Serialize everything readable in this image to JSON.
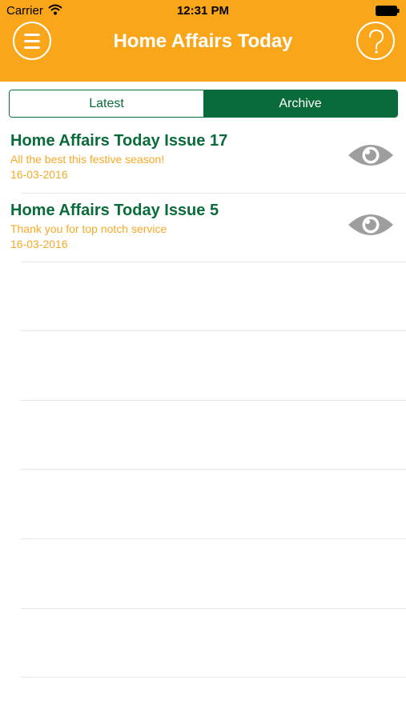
{
  "status_bar": {
    "carrier": "Carrier",
    "time": "12:31 PM",
    "icons": [
      "wifi-icon",
      "battery-icon"
    ]
  },
  "nav": {
    "title": "Home Affairs Today",
    "left_icon": "menu-icon",
    "right_icon": "help-icon",
    "bar_color": "#f9a61a"
  },
  "segmented": {
    "options": [
      "Latest",
      "Archive"
    ],
    "selected": "Archive",
    "accent_color": "#0a6b3a"
  },
  "issues": [
    {
      "title": "Home Affairs Today Issue 17",
      "subtitle": "All the best this festive season!",
      "date": "16-03-2016",
      "icon": "eye-icon"
    },
    {
      "title": "Home Affairs Today Issue 5",
      "subtitle": "Thank you for top notch service",
      "date": "16-03-2016",
      "icon": "eye-icon"
    }
  ],
  "colors": {
    "title_text": "#0a6b3a",
    "meta_text": "#f7a928",
    "icon_gray": "#9e9e9e"
  }
}
